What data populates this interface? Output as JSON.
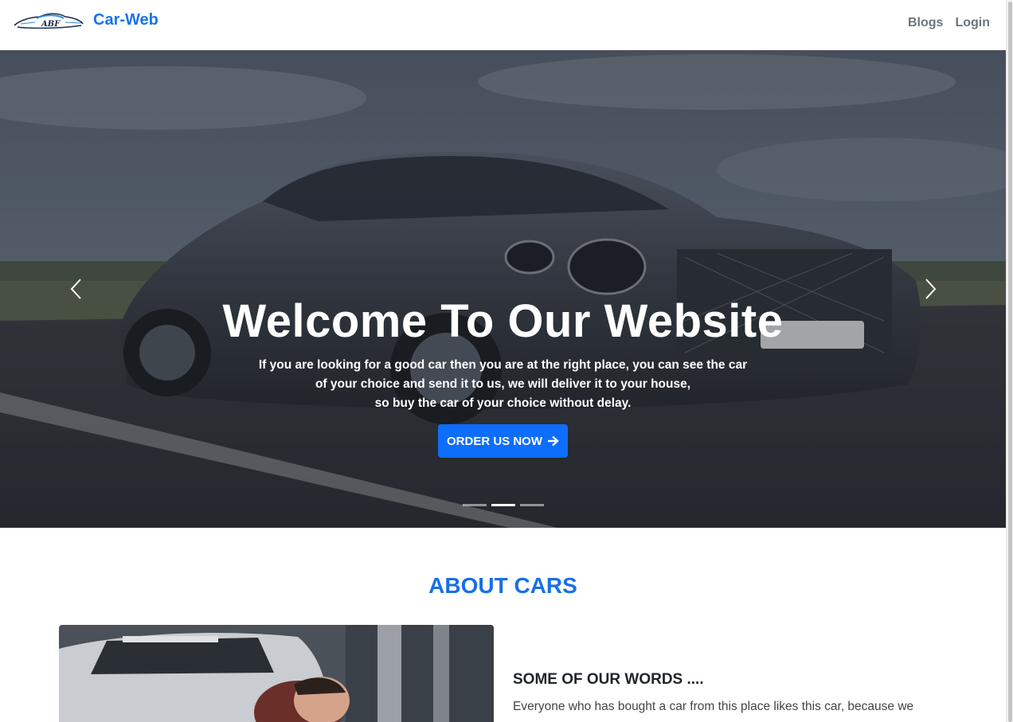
{
  "navbar": {
    "brand_name": "Car-Web",
    "links": [
      {
        "label": "Blogs"
      },
      {
        "label": "Login"
      }
    ]
  },
  "hero": {
    "title": "Welcome To Our Website",
    "subtitle_lines": [
      "If you are looking for a good car then you are at the right place, you can see the car",
      "of your choice and send it to us, we will deliver it to your house,",
      "so buy the car of your choice without delay."
    ],
    "button_label": "ORDER US NOW",
    "button_icon": "arrow-right-icon",
    "active_slide": 2,
    "slide_count": 3
  },
  "about": {
    "title": "ABOUT CARS",
    "heading": "SOME OF OUR WORDS ....",
    "text": "Everyone who has bought a car from this place likes this car, because we"
  },
  "colors": {
    "brand": "#1a73e8",
    "primary_button": "#0d6efd",
    "about_title": "#1a6fe6",
    "nav_link": "#6c757d"
  }
}
